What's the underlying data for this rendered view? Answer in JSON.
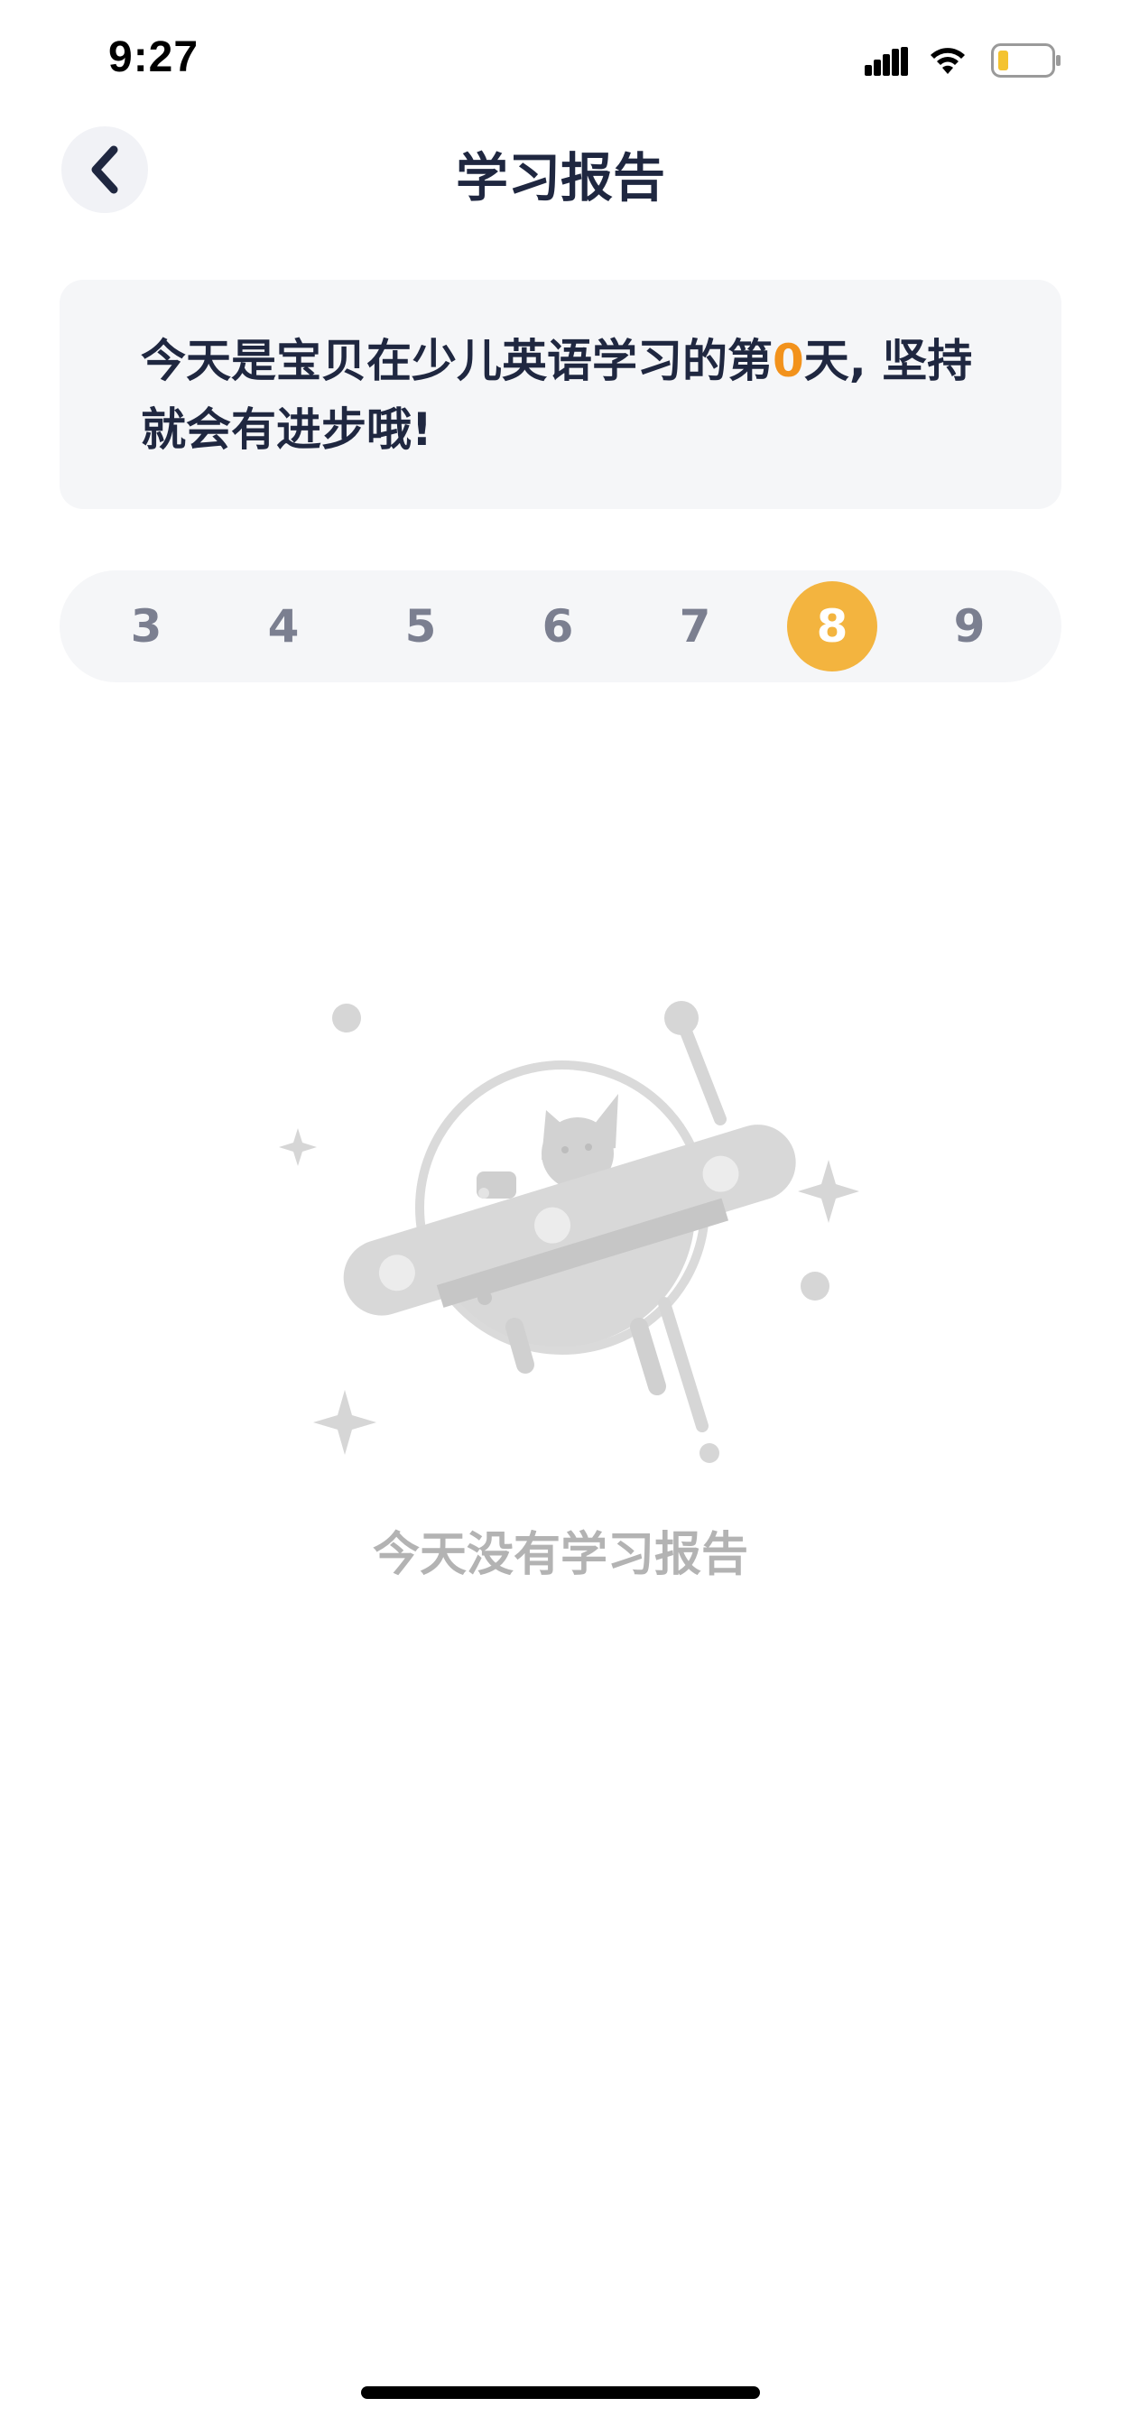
{
  "status_bar": {
    "time": "9:27"
  },
  "header": {
    "title": "学习报告",
    "back_icon": "chevron-left-icon"
  },
  "message": {
    "prefix": "今天是宝贝在少儿英语学习的第",
    "day_count": "0",
    "suffix": "天, 坚持就会有进步哦!"
  },
  "day_selector": {
    "days": [
      "3",
      "4",
      "5",
      "6",
      "7",
      "8",
      "9"
    ],
    "selected": "8"
  },
  "empty_state": {
    "illustration": "ufo-cat-icon",
    "text": "今天没有学习报告"
  },
  "colors": {
    "accent": "#f3b43f",
    "highlight": "#f2921c",
    "title_text": "#1f2740",
    "muted_text": "#b3b3b3",
    "card_bg": "#f5f6f8"
  }
}
